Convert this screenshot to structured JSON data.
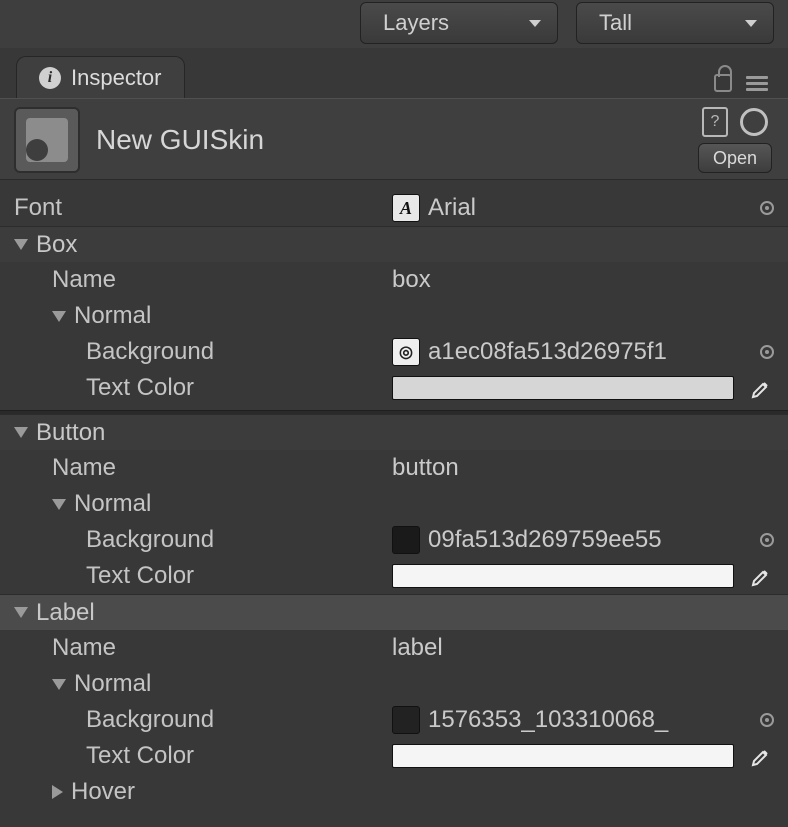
{
  "toolbar": {
    "dropdowns": [
      {
        "label": "Layers"
      },
      {
        "label": "Tall"
      }
    ]
  },
  "tab": {
    "title": "Inspector"
  },
  "asset": {
    "name": "New GUISkin",
    "open_label": "Open"
  },
  "font_row": {
    "label": "Font",
    "value": "Arial",
    "thumb_glyph": "A"
  },
  "styles": [
    {
      "title": "Box",
      "name_label": "Name",
      "name_value": "box",
      "normal_label": "Normal",
      "background_label": "Background",
      "background_value": "a1ec08fa513d26975f1",
      "textcolor_label": "Text Color",
      "textcolor_hex": "#d6d6d6",
      "thumb_class": "",
      "highlight": false
    },
    {
      "title": "Button",
      "name_label": "Name",
      "name_value": "button",
      "normal_label": "Normal",
      "background_label": "Background",
      "background_value": "09fa513d269759ee55",
      "textcolor_label": "Text Color",
      "textcolor_hex": "#f5f5f5",
      "thumb_class": "dark",
      "highlight": false
    },
    {
      "title": "Label",
      "name_label": "Name",
      "name_value": "label",
      "normal_label": "Normal",
      "background_label": "Background",
      "background_value": "1576353_103310068_",
      "textcolor_label": "Text Color",
      "textcolor_hex": "#f5f5f5",
      "thumb_class": "dark2",
      "highlight": true,
      "hover_label": "Hover"
    }
  ]
}
